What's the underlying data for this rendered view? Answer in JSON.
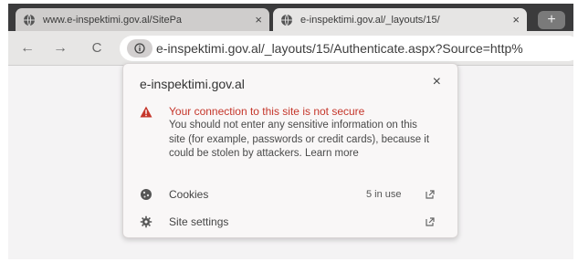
{
  "tabs": [
    {
      "title": "www.e-inspektimi.gov.al/SitePa",
      "icon": "globe-icon"
    },
    {
      "title": "e-inspektimi.gov.al/_layouts/15/",
      "icon": "globe-icon"
    }
  ],
  "tab_close_glyph": "×",
  "new_tab_glyph": "+",
  "toolbar": {
    "back": "←",
    "forward": "→",
    "reload": "C",
    "url": "e-inspektimi.gov.al/_layouts/15/Authenticate.aspx?Source=http%"
  },
  "popup": {
    "domain": "e-inspektimi.gov.al",
    "close": "×",
    "warning_title": "Your connection to this site is not secure",
    "warning_body": "You should not enter any sensitive information on this site (for example, passwords or credit cards), because it could be stolen by attackers.",
    "learn_more": "Learn more",
    "rows": [
      {
        "label": "Cookies",
        "meta": "5 in use",
        "icon": "cookie-icon"
      },
      {
        "label": "Site settings",
        "meta": "",
        "icon": "gear-icon"
      }
    ]
  },
  "colors": {
    "warning": "#c5362b",
    "tabstrip": "#3b3b3c",
    "toolbar": "#e7e6e5"
  }
}
